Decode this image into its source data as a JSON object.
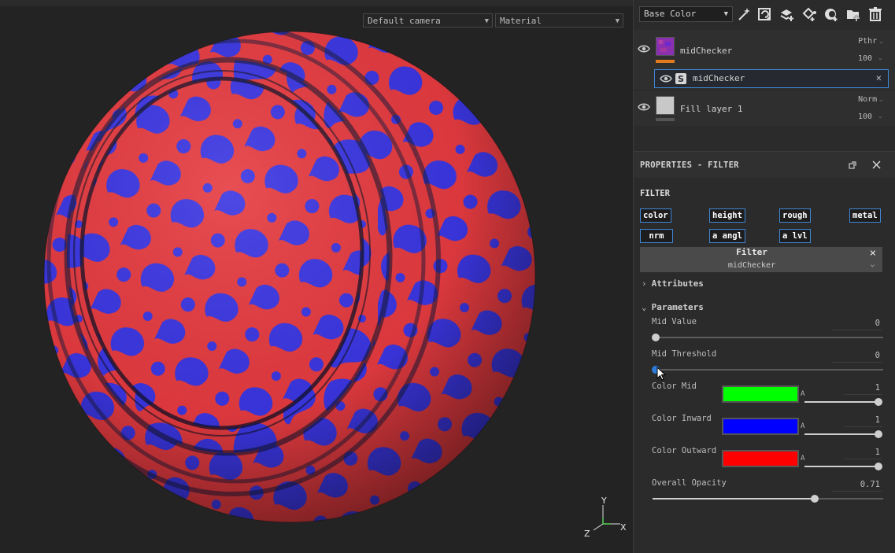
{
  "viewport": {
    "camera_select": "Default camera",
    "mode_select": "Material",
    "axes": {
      "y": "Y",
      "z": "Z",
      "x": "X"
    }
  },
  "toolbar": {
    "channel": "Base Color",
    "icons": [
      "magic-wand-icon",
      "refresh-layer-icon",
      "add-layer-icon",
      "fill-bucket-icon",
      "mask-icon",
      "add-folder-icon",
      "trash-icon"
    ]
  },
  "layers": [
    {
      "name": "midChecker",
      "blend": "Pthr",
      "opacity": "100",
      "accent_color": "#e07a1c",
      "effects": [
        {
          "name": "midChecker",
          "icon": "substance-icon",
          "close": "×"
        }
      ]
    },
    {
      "name": "Fill layer 1",
      "blend": "Norm",
      "opacity": "100"
    }
  ],
  "properties": {
    "title": "PROPERTIES - FILTER",
    "section": "FILTER",
    "channels": [
      "color",
      "height",
      "rough",
      "metal",
      "nrm",
      "a angl",
      "a lvl"
    ],
    "filter_header": {
      "label": "Filter",
      "value": "midChecker",
      "close": "×"
    },
    "attributes_label": "Attributes",
    "parameters_label": "Parameters",
    "params": {
      "mid_value": {
        "label": "Mid Value",
        "value": "0",
        "fraction": 0.0
      },
      "mid_threshold": {
        "label": "Mid Threshold",
        "value": "0",
        "fraction": 0.0
      },
      "color_mid": {
        "label": "Color Mid",
        "value": "1",
        "color": "#00ff00",
        "alpha": "A",
        "fraction": 1.0
      },
      "color_inward": {
        "label": "Color Inward",
        "value": "1",
        "color": "#0000ff",
        "alpha": "A",
        "fraction": 1.0
      },
      "color_outward": {
        "label": "Color Outward",
        "value": "1",
        "color": "#ff0000",
        "alpha": "A",
        "fraction": 1.0
      },
      "overall_opacity": {
        "label": "Overall Opacity",
        "value": "0.71",
        "fraction": 0.71
      }
    }
  },
  "colors": {
    "accent_blue": "#3f86d6",
    "slider_active": "#2d7bd8"
  }
}
